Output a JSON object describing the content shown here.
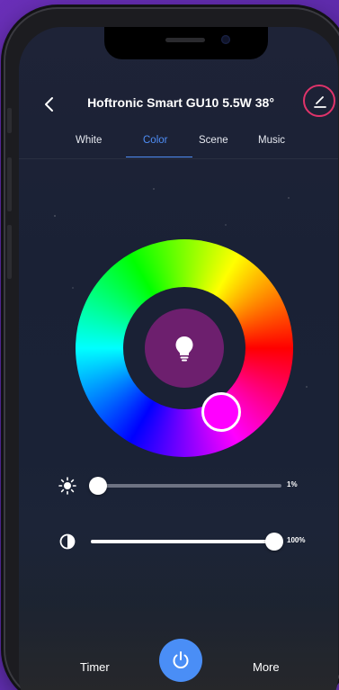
{
  "header": {
    "title": "Hoftronic Smart GU10 5.5W 38°",
    "back_icon": "chevron-left-icon",
    "edit_icon": "edit-icon"
  },
  "tabs": [
    {
      "label": "White",
      "active": false
    },
    {
      "label": "Color",
      "active": true
    },
    {
      "label": "Scene",
      "active": false
    },
    {
      "label": "Music",
      "active": false
    }
  ],
  "color_wheel": {
    "selected_color": "#ff00ff",
    "center_color": "#6d1f6e",
    "center_icon": "lightbulb-icon"
  },
  "sliders": {
    "brightness": {
      "icon": "sun-icon",
      "value_label": "1%",
      "value": 0.01
    },
    "saturation": {
      "icon": "contrast-icon",
      "value_label": "100%",
      "value": 1.0
    }
  },
  "bottom_bar": {
    "timer_label": "Timer",
    "more_label": "More",
    "power_icon": "power-icon"
  },
  "colors": {
    "accent": "#4f8ef6",
    "edit_ring": "#e0336a"
  }
}
